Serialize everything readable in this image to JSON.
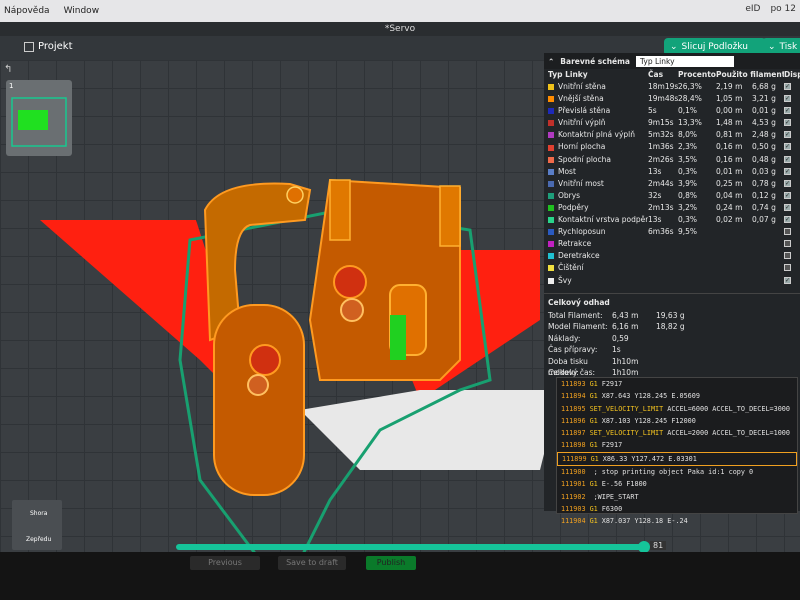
{
  "menubar": {
    "items": [
      "Nápověda",
      "Window"
    ],
    "status": [
      "eID",
      "po 12"
    ]
  },
  "window_title": "*Servo",
  "toolbar": {
    "project_label": "Projekt",
    "slice_label": "Slicuj Podložku",
    "print_label": "Tisk"
  },
  "plate": {
    "number": "1"
  },
  "legend": {
    "title": "Barevné schéma",
    "select": "Typ Linky",
    "headers": [
      "Typ Linky",
      "Čas",
      "Procento",
      "Použito filamentu",
      "Displej"
    ],
    "rows": [
      {
        "name": "Vnitřní stěna",
        "time": "18m19s",
        "pct": "26,3%",
        "len": "2,19 m",
        "g": "6,68 g",
        "color": "#f0c21a",
        "on": true
      },
      {
        "name": "Vnější stěna",
        "time": "19m48s",
        "pct": "28,4%",
        "len": "1,05 m",
        "g": "3,21 g",
        "color": "#ff8c00",
        "on": true
      },
      {
        "name": "Převislá stěna",
        "time": "5s",
        "pct": "0,1%",
        "len": "0,00 m",
        "g": "0,01 g",
        "color": "#1e2ab8",
        "on": true
      },
      {
        "name": "Vnitřní výplň",
        "time": "9m15s",
        "pct": "13,3%",
        "len": "1,48 m",
        "g": "4,53 g",
        "color": "#c0302a",
        "on": true
      },
      {
        "name": "Kontaktní plná výplň",
        "time": "5m32s",
        "pct": "8,0%",
        "len": "0,81 m",
        "g": "2,48 g",
        "color": "#b03ac0",
        "on": true
      },
      {
        "name": "Horní plocha",
        "time": "1m36s",
        "pct": "2,3%",
        "len": "0,16 m",
        "g": "0,50 g",
        "color": "#e04030",
        "on": true
      },
      {
        "name": "Spodní plocha",
        "time": "2m26s",
        "pct": "3,5%",
        "len": "0,16 m",
        "g": "0,48 g",
        "color": "#f06a4a",
        "on": true
      },
      {
        "name": "Most",
        "time": "13s",
        "pct": "0,3%",
        "len": "0,01 m",
        "g": "0,03 g",
        "color": "#5a7ec8",
        "on": true
      },
      {
        "name": "Vnitřní most",
        "time": "2m44s",
        "pct": "3,9%",
        "len": "0,25 m",
        "g": "0,78 g",
        "color": "#4a6ab0",
        "on": true
      },
      {
        "name": "Obrys",
        "time": "32s",
        "pct": "0,8%",
        "len": "0,04 m",
        "g": "0,12 g",
        "color": "#1e9e7a",
        "on": true
      },
      {
        "name": "Podpěry",
        "time": "2m13s",
        "pct": "3,2%",
        "len": "0,24 m",
        "g": "0,74 g",
        "color": "#20c020",
        "on": true
      },
      {
        "name": "Kontaktní vrstva podpěr",
        "time": "13s",
        "pct": "0,3%",
        "len": "0,02 m",
        "g": "0,07 g",
        "color": "#2ad48a",
        "on": true
      },
      {
        "name": "Rychloposun",
        "time": "6m36s",
        "pct": "9,5%",
        "len": "",
        "g": "",
        "color": "#2a5ac0",
        "on": false
      },
      {
        "name": "Retrakce",
        "time": "",
        "pct": "",
        "len": "",
        "g": "",
        "color": "#c020c0",
        "on": false
      },
      {
        "name": "Deretrakce",
        "time": "",
        "pct": "",
        "len": "",
        "g": "",
        "color": "#20c0d0",
        "on": false
      },
      {
        "name": "Čištění",
        "time": "",
        "pct": "",
        "len": "",
        "g": "",
        "color": "#f0e040",
        "on": false
      },
      {
        "name": "Švy",
        "time": "",
        "pct": "",
        "len": "",
        "g": "",
        "color": "#eeeeee",
        "on": true
      }
    ]
  },
  "summary": {
    "title": "Celkový odhad",
    "rows": [
      {
        "k": "Total Filament:",
        "v1": "6,43 m",
        "v2": "19,63 g"
      },
      {
        "k": "Model Filament:",
        "v1": "6,16 m",
        "v2": "18,82 g"
      },
      {
        "k": "Náklady:",
        "v1": "0,59",
        "v2": ""
      },
      {
        "k": "Čas přípravy:",
        "v1": "1s",
        "v2": ""
      },
      {
        "k": "Doba tisku modelu:",
        "v1": "1h10m",
        "v2": ""
      },
      {
        "k": "Celkový čas:",
        "v1": "1h10m",
        "v2": ""
      }
    ]
  },
  "gcode": [
    {
      "ln": "111893",
      "kw": "G1",
      "rest": "F2917"
    },
    {
      "ln": "111894",
      "kw": "G1",
      "rest": "X87.643 Y128.245 E.05609"
    },
    {
      "ln": "111895",
      "kw": "SET_VELOCITY_LIMIT",
      "rest": "ACCEL=6000 ACCEL_TO_DECEL=3000"
    },
    {
      "ln": "111896",
      "kw": "G1",
      "rest": "X87.103 Y128.245 F12000"
    },
    {
      "ln": "111897",
      "kw": "SET_VELOCITY_LIMIT",
      "rest": "ACCEL=2000 ACCEL_TO_DECEL=1000"
    },
    {
      "ln": "111898",
      "kw": "G1",
      "rest": "F2917"
    },
    {
      "ln": "111899",
      "kw": "G1",
      "rest": "X86.33 Y127.472 E.03301",
      "hl": true
    },
    {
      "ln": "111900",
      "kw": "",
      "rest": "; stop printing object Paka id:1 copy 0"
    },
    {
      "ln": "111901",
      "kw": "G1",
      "rest": "E-.56 F1800"
    },
    {
      "ln": "111902",
      "kw": "",
      "rest": ";WIPE_START"
    },
    {
      "ln": "111903",
      "kw": "G1",
      "rest": "F6300"
    },
    {
      "ln": "111904",
      "kw": "G1",
      "rest": "X87.037 Y128.18 E-.24"
    }
  ],
  "layer_slider": {
    "value": "81"
  },
  "navcube": {
    "top": "Shora",
    "front": "Zepředu"
  },
  "bottom_buttons": [
    "Previous",
    "Save to draft",
    "Publish"
  ]
}
